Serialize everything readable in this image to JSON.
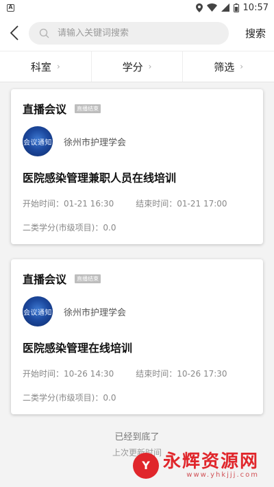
{
  "status_bar": {
    "time": "10:57",
    "notification_icon": "A"
  },
  "header": {
    "search_placeholder": "请输入关键词搜索",
    "search_button": "搜索"
  },
  "filters": [
    {
      "label": "科室"
    },
    {
      "label": "学分"
    },
    {
      "label": "筛选"
    }
  ],
  "cards": [
    {
      "type": "直播会议",
      "badge": "直播结束",
      "avatar_text": "会议通知",
      "org": "徐州市护理学会",
      "title": "医院感染管理兼职人员在线培训",
      "start": "开始时间：01-21 16:30",
      "end": "结束时间：01-21 17:00",
      "credit": "二类学分(市级项目)：0.0"
    },
    {
      "type": "直播会议",
      "badge": "直播结束",
      "avatar_text": "会议通知",
      "org": "徐州市护理学会",
      "title": "医院感染管理在线培训",
      "start": "开始时间：10-26 14:30",
      "end": "结束时间：10-26 17:30",
      "credit": "二类学分(市级项目)：0.0"
    }
  ],
  "footer": {
    "end_text": "已经到底了",
    "line2": "上次更新时间"
  },
  "watermark": {
    "logo_glyph": "Y",
    "main": "永辉资源网",
    "sub": "www.yhkjjj.com"
  },
  "colors": {
    "watermark_red": "#e0262b",
    "badge_gray": "#bdbdbd"
  }
}
